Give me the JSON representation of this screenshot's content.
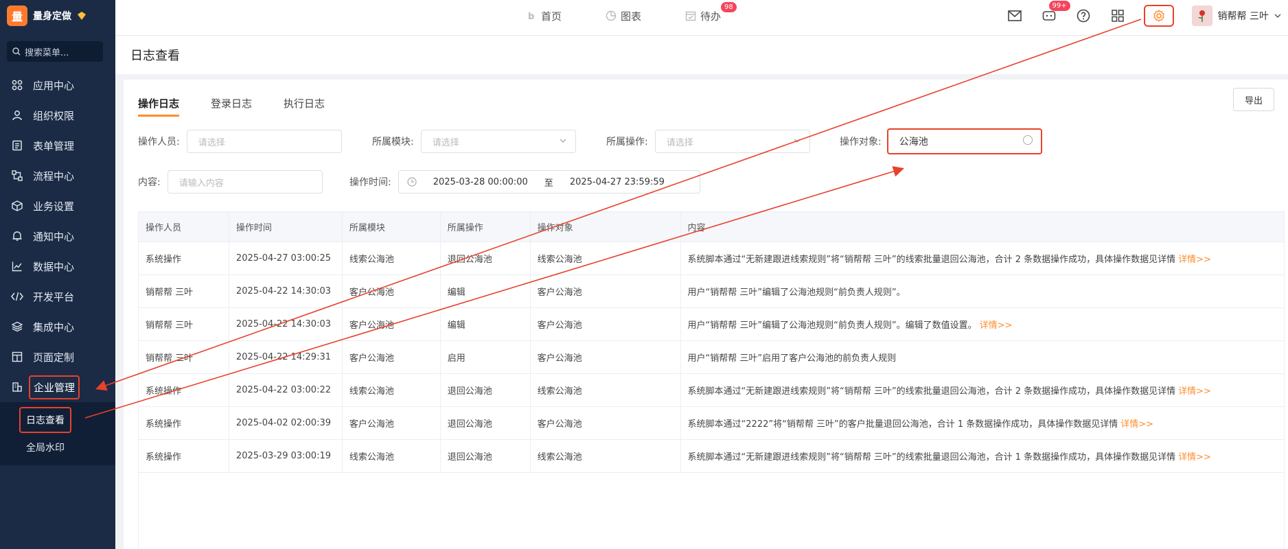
{
  "brand": {
    "logo": "量",
    "name": "量身定做"
  },
  "search": {
    "placeholder": "搜索菜单..."
  },
  "sidebar": {
    "items": [
      {
        "label": "应用中心",
        "icon": "apps-icon"
      },
      {
        "label": "组织权限",
        "icon": "user-icon"
      },
      {
        "label": "表单管理",
        "icon": "form-icon"
      },
      {
        "label": "流程中心",
        "icon": "flow-icon"
      },
      {
        "label": "业务设置",
        "icon": "cube-icon"
      },
      {
        "label": "通知中心",
        "icon": "bell-icon"
      },
      {
        "label": "数据中心",
        "icon": "chart-icon"
      },
      {
        "label": "开发平台",
        "icon": "code-icon"
      },
      {
        "label": "集成中心",
        "icon": "layers-icon"
      },
      {
        "label": "页面定制",
        "icon": "layout-icon"
      },
      {
        "label": "企业管理",
        "icon": "building-icon"
      }
    ],
    "sub_items": [
      {
        "label": "日志查看"
      },
      {
        "label": "全局水印"
      }
    ]
  },
  "topnav": {
    "home": "首页",
    "charts": "图表",
    "todo": "待办",
    "todo_badge": "98",
    "message_badge": "99+"
  },
  "user": {
    "name": "销帮帮 三叶"
  },
  "page": {
    "title": "日志查看"
  },
  "tabs": [
    "操作日志",
    "登录日志",
    "执行日志"
  ],
  "export_label": "导出",
  "filters": {
    "operator_label": "操作人员:",
    "operator_placeholder": "请选择",
    "module_label": "所属模块:",
    "module_placeholder": "请选择",
    "operation_label": "所属操作:",
    "operation_placeholder": "请选择",
    "target_label": "操作对象:",
    "target_value": "公海池",
    "content_label": "内容:",
    "content_placeholder": "请输入内容",
    "time_label": "操作时间:",
    "time_start": "2025-03-28 00:00:00",
    "time_sep": "至",
    "time_end": "2025-04-27 23:59:59"
  },
  "table": {
    "headers": [
      "操作人员",
      "操作时间",
      "所属模块",
      "所属操作",
      "操作对象",
      "内容"
    ],
    "detail_label": "详情>>",
    "rows": [
      [
        "系统操作",
        "2025-04-27 03:00:25",
        "线索公海池",
        "退回公海池",
        "线索公海池",
        "系统脚本通过“无新建跟进线索规则”将“销帮帮 三叶”的线索批量退回公海池，合计 2 条数据操作成功，具体操作数据见详情"
      ],
      [
        "销帮帮 三叶",
        "2025-04-22 14:30:03",
        "客户公海池",
        "编辑",
        "客户公海池",
        "用户“销帮帮 三叶”编辑了公海池规则“前负责人规则”。"
      ],
      [
        "销帮帮 三叶",
        "2025-04-22 14:30:03",
        "客户公海池",
        "编辑",
        "客户公海池",
        "用户“销帮帮 三叶”编辑了公海池规则“前负责人规则”。编辑了数值设置。"
      ],
      [
        "销帮帮 三叶",
        "2025-04-22 14:29:31",
        "客户公海池",
        "启用",
        "客户公海池",
        "用户“销帮帮 三叶”启用了客户公海池的前负责人规则"
      ],
      [
        "系统操作",
        "2025-04-22 03:00:22",
        "线索公海池",
        "退回公海池",
        "线索公海池",
        "系统脚本通过“无新建跟进线索规则”将“销帮帮 三叶”的线索批量退回公海池，合计 2 条数据操作成功，具体操作数据见详情"
      ],
      [
        "系统操作",
        "2025-04-02 02:00:39",
        "客户公海池",
        "退回公海池",
        "客户公海池",
        "系统脚本通过“2222”将“销帮帮 三叶”的客户批量退回公海池，合计 1 条数据操作成功，具体操作数据见详情"
      ],
      [
        "系统操作",
        "2025-03-29 03:00:19",
        "线索公海池",
        "退回公海池",
        "线索公海池",
        "系统脚本通过“无新建跟进线索规则”将“销帮帮 三叶”的线索批量退回公海池，合计 1 条数据操作成功，具体操作数据见详情"
      ]
    ],
    "row_has_detail": [
      true,
      false,
      true,
      false,
      true,
      true,
      true
    ]
  },
  "colors": {
    "accent": "#ff8c2b",
    "highlight": "#e8412c",
    "sidebar_bg": "#1b2b45"
  }
}
